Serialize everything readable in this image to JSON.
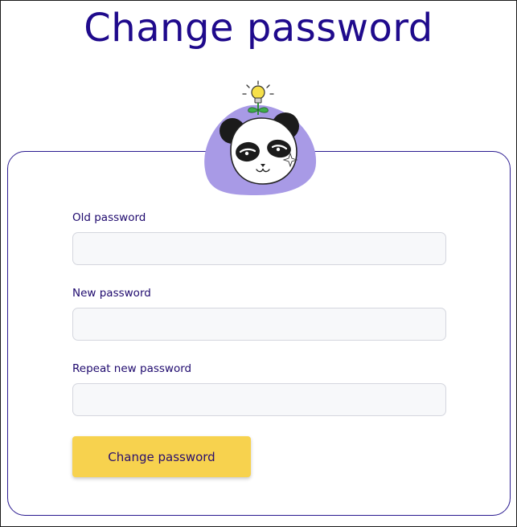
{
  "page": {
    "title": "Change password"
  },
  "form": {
    "fields": [
      {
        "label": "Old password",
        "value": "",
        "placeholder": ""
      },
      {
        "label": "New password",
        "value": "",
        "placeholder": ""
      },
      {
        "label": "Repeat new password",
        "value": "",
        "placeholder": ""
      }
    ],
    "submit_label": "Change password"
  },
  "mascot": {
    "icon": "panda-with-lightbulb-icon"
  },
  "colors": {
    "title": "#1f0a8c",
    "card_border": "#2a1a90",
    "button_bg": "#f7d24e",
    "button_text": "#2a0f6e",
    "mascot_blob": "#a89ae6",
    "input_bg": "#f7f8fa"
  }
}
